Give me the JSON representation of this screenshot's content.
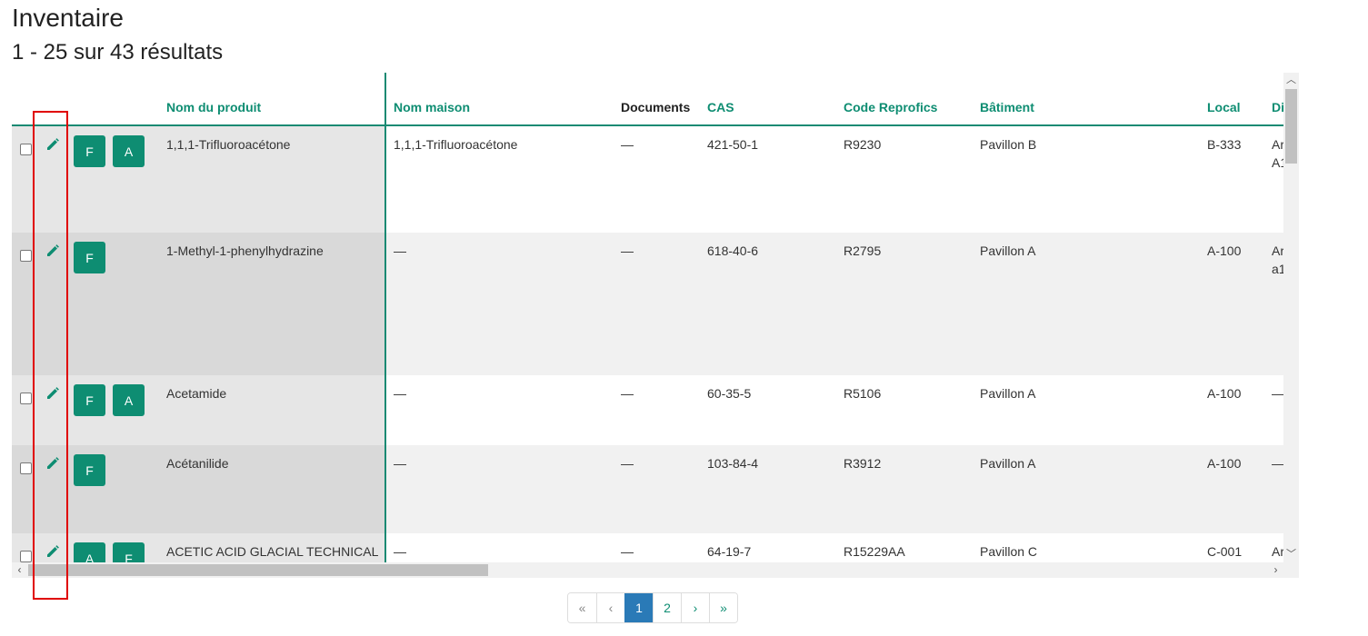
{
  "page": {
    "title": "Inventaire",
    "result_count": "1 - 25 sur 43 résultats"
  },
  "columns": {
    "product_name": "Nom du produit",
    "house_name": "Nom maison",
    "documents": "Documents",
    "cas": "CAS",
    "reprofics": "Code Reprofics",
    "building": "Bâtiment",
    "local": "Local",
    "next": "Di"
  },
  "rows": [
    {
      "tags": [
        "F",
        "A"
      ],
      "product_name": "1,1,1-Trifluoroacétone",
      "house_name": "1,1,1-Trifluoroacétone",
      "documents": "—",
      "cas": "421-50-1",
      "reprofics": "R9230",
      "building": "Pavillon B",
      "local": "B-333",
      "extra_line1": "Ar",
      "extra_line2": "A1"
    },
    {
      "tags": [
        "F"
      ],
      "product_name": "1-Methyl-1-phenylhydrazine",
      "house_name": "—",
      "documents": "—",
      "cas": "618-40-6",
      "reprofics": "R2795",
      "building": "Pavillon A",
      "local": "A-100",
      "extra_line1": "Ar",
      "extra_line2": "a1"
    },
    {
      "tags": [
        "F",
        "A"
      ],
      "product_name": "Acetamide",
      "house_name": "—",
      "documents": "—",
      "cas": "60-35-5",
      "reprofics": "R5106",
      "building": "Pavillon A",
      "local": "A-100",
      "extra_line1": "—",
      "extra_line2": ""
    },
    {
      "tags": [
        "F"
      ],
      "product_name": "Acétanilide",
      "house_name": "—",
      "documents": "—",
      "cas": "103-84-4",
      "reprofics": "R3912",
      "building": "Pavillon A",
      "local": "A-100",
      "extra_line1": "—",
      "extra_line2": ""
    },
    {
      "tags": [
        "A",
        "F"
      ],
      "product_name": "ACETIC ACID GLACIAL TECHNICAL",
      "house_name": "—",
      "documents": "—",
      "cas": "64-19-7",
      "reprofics": "R15229AA",
      "building": "Pavillon C",
      "local": "C-001",
      "extra_line1": "Ar",
      "extra_line2": ""
    }
  ],
  "pagination": {
    "first": "«",
    "prev": "‹",
    "pages": [
      "1",
      "2"
    ],
    "current": "1",
    "next": "›",
    "last": "»"
  },
  "scrollbar": {
    "up": "︿",
    "down": "﹀",
    "left": "‹",
    "right": "›"
  },
  "colors": {
    "accent": "#0e8d72",
    "highlight": "#e00000",
    "active_page": "#2a7ab7"
  },
  "icons": {
    "edit": "pencil-icon"
  }
}
